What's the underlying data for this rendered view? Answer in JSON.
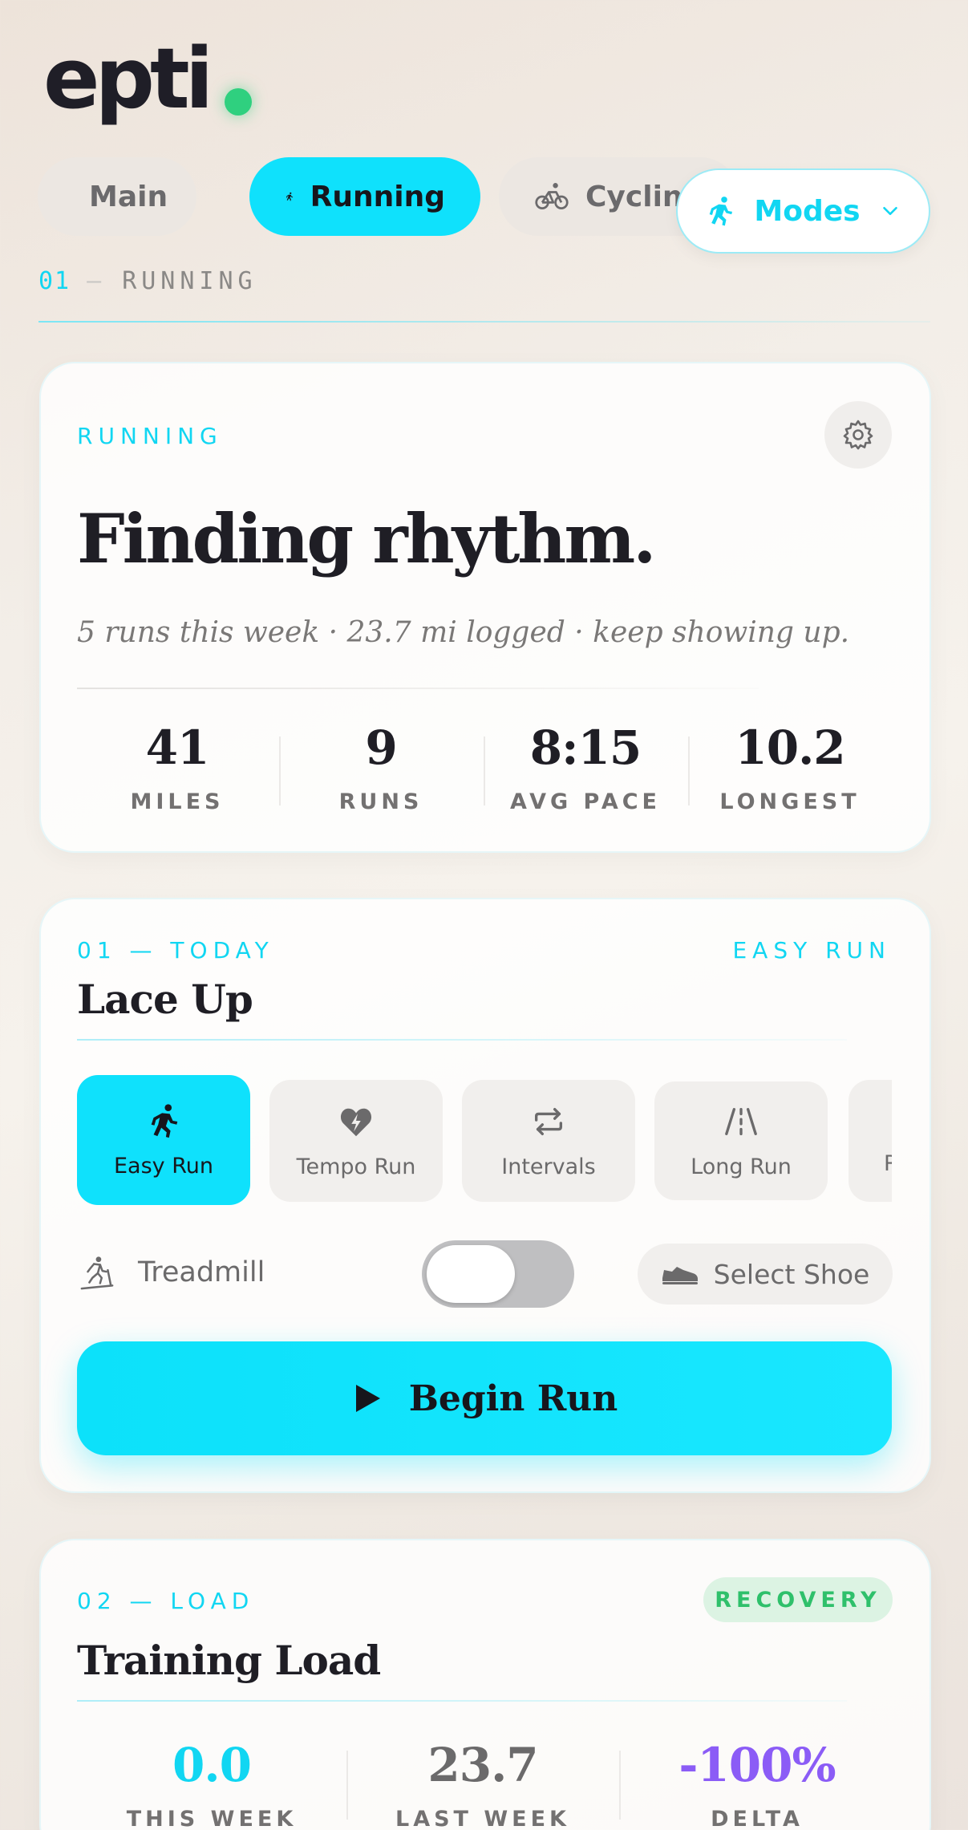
{
  "header": {
    "logo_text": "epti",
    "tabs": [
      {
        "label": "Main",
        "icon": "weightlifter-icon"
      },
      {
        "label": "Running",
        "icon": "runner-icon",
        "active": true
      },
      {
        "label": "Cycling",
        "icon": "bicycle-icon"
      }
    ],
    "modes_label": "Modes"
  },
  "section": {
    "number": "01",
    "dash": "—",
    "label": "RUNNING"
  },
  "summary": {
    "eyebrow": "RUNNING",
    "title": "Finding rhythm.",
    "subtitle": "5 runs this week · 23.7 mi logged · keep showing up.",
    "stats": [
      {
        "value": "41",
        "label": "MILES"
      },
      {
        "value": "9",
        "label": "RUNS"
      },
      {
        "value": "8:15",
        "label": "AVG PACE"
      },
      {
        "value": "10.2",
        "label": "LONGEST"
      }
    ]
  },
  "today": {
    "eyebrow": "01 — TODAY",
    "tag": "EASY RUN",
    "title": "Lace Up",
    "types": [
      {
        "label": "Easy Run",
        "icon": "runner-icon",
        "active": true
      },
      {
        "label": "Tempo Run",
        "icon": "heart-bolt-icon"
      },
      {
        "label": "Intervals",
        "icon": "repeat-icon"
      },
      {
        "label": "Long Run",
        "icon": "road-icon"
      }
    ],
    "partial_type_label": "R",
    "treadmill_label": "Treadmill",
    "shoe_label": "Select Shoe",
    "begin_label": "Begin Run"
  },
  "load": {
    "eyebrow": "02 — LOAD",
    "badge": "RECOVERY",
    "title": "Training Load",
    "stats": [
      {
        "value": "0.0",
        "label": "THIS WEEK"
      },
      {
        "value": "23.7",
        "label": "LAST WEEK"
      },
      {
        "value": "-100%",
        "label": "DELTA"
      }
    ]
  },
  "colors": {
    "accent": "#0fe1fc",
    "green": "#2fd07f",
    "purple": "#8b5cf6"
  }
}
